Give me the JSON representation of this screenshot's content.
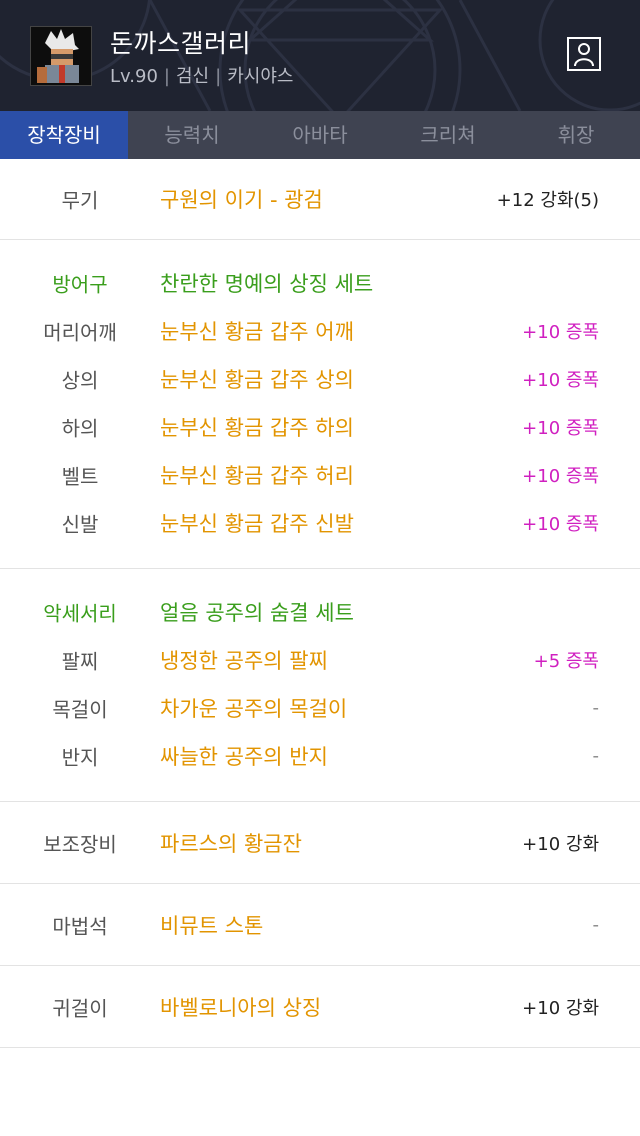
{
  "header": {
    "character_name": "돈까스갤러리",
    "level": "Lv.90",
    "job": "검신",
    "server": "카시야스",
    "separator": "|"
  },
  "tabs": [
    {
      "label": "장착장비",
      "active": true
    },
    {
      "label": "능력치",
      "active": false
    },
    {
      "label": "아바타",
      "active": false
    },
    {
      "label": "크리쳐",
      "active": false
    },
    {
      "label": "휘장",
      "active": false
    }
  ],
  "weapon": {
    "slot": "무기",
    "item": "구원의 이기 - 광검",
    "enhance": "+12 강화(5)"
  },
  "armor": {
    "group_label": "방어구",
    "set_name": "찬란한 명예의 상징 세트",
    "items": [
      {
        "slot": "머리어깨",
        "item": "눈부신 황금 갑주 어깨",
        "enhance": "+10 증폭"
      },
      {
        "slot": "상의",
        "item": "눈부신 황금 갑주 상의",
        "enhance": "+10 증폭"
      },
      {
        "slot": "하의",
        "item": "눈부신 황금 갑주 하의",
        "enhance": "+10 증폭"
      },
      {
        "slot": "벨트",
        "item": "눈부신 황금 갑주 허리",
        "enhance": "+10 증폭"
      },
      {
        "slot": "신발",
        "item": "눈부신 황금 갑주 신발",
        "enhance": "+10 증폭"
      }
    ]
  },
  "accessory": {
    "group_label": "악세서리",
    "set_name": "얼음 공주의 숨결 세트",
    "items": [
      {
        "slot": "팔찌",
        "item": "냉정한 공주의 팔찌",
        "enhance": "+5 증폭"
      },
      {
        "slot": "목걸이",
        "item": "차가운 공주의 목걸이",
        "enhance": "-"
      },
      {
        "slot": "반지",
        "item": "싸늘한 공주의 반지",
        "enhance": "-"
      }
    ]
  },
  "sub_equipment": {
    "slot": "보조장비",
    "item": "파르스의 황금잔",
    "enhance": "+10 강화"
  },
  "magic_stone": {
    "slot": "마법석",
    "item": "비뮤트 스톤",
    "enhance": "-"
  },
  "earring": {
    "slot": "귀걸이",
    "item": "바벨로니아의 상징",
    "enhance": "+10 강화"
  },
  "colors": {
    "header_bg": "#1f2330",
    "tab_bar_bg": "#3f4351",
    "tab_active_bg": "#2b4fa8",
    "item_name": "#e29400",
    "set_green": "#3a9e1c",
    "amplify_magenta": "#d020c0"
  }
}
